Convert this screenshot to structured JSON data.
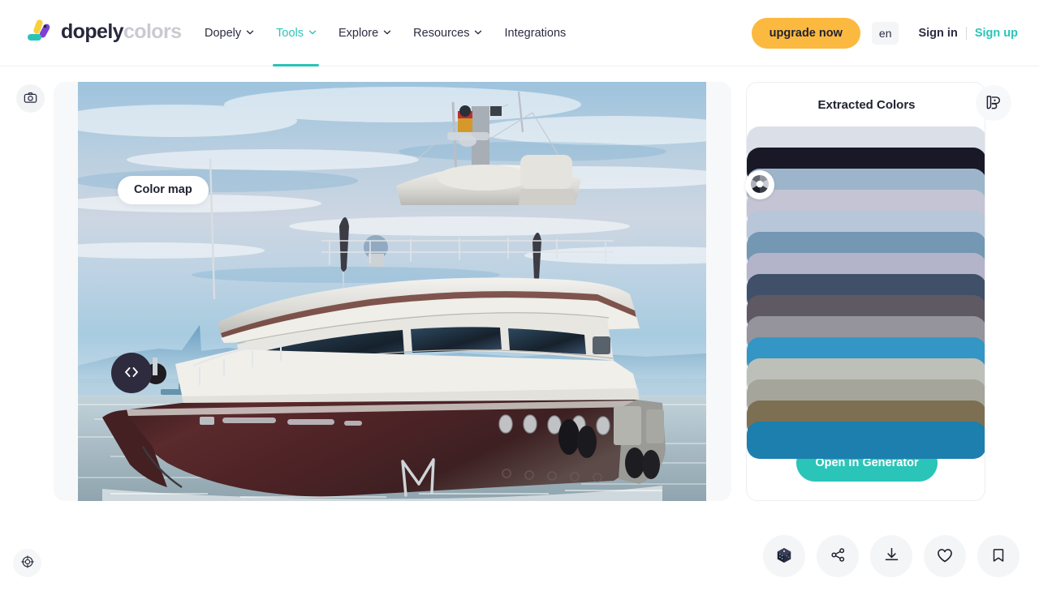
{
  "brand": {
    "name_primary": "dopely",
    "name_secondary": "colors",
    "accent_teal": "#2ac4b8",
    "accent_orange": "#fcb93f",
    "dark": "#27283c"
  },
  "nav": {
    "items": [
      {
        "label": "Dopely",
        "has_caret": true,
        "active": false
      },
      {
        "label": "Tools",
        "has_caret": true,
        "active": true
      },
      {
        "label": "Explore",
        "has_caret": true,
        "active": false
      },
      {
        "label": "Resources",
        "has_caret": true,
        "active": false
      },
      {
        "label": "Integrations",
        "has_caret": false,
        "active": false
      }
    ]
  },
  "header_actions": {
    "upgrade_label": "upgrade now",
    "language": "en",
    "signin_label": "Sign in",
    "signup_label": "Sign up"
  },
  "image_viewer": {
    "colormap_label": "Color map",
    "camera_icon": "camera-icon",
    "arrows_icon": "prev-next-chevrons-icon",
    "picker_icon": "color-wheel-picker-icon",
    "target_icon": "target-crosshair-icon",
    "photo_alt": "white and dark-hulled motor yacht on calm sea under blue sky"
  },
  "palette": {
    "title": "Extracted Colors",
    "generator_label": "Open in Generator",
    "palette_icon": "palette-book-icon",
    "swatches": [
      {
        "hex": "#dbdfe8"
      },
      {
        "hex": "#191827"
      },
      {
        "hex": "#9db5cb"
      },
      {
        "hex": "#c4c4d4"
      },
      {
        "hex": "#b7c6d8"
      },
      {
        "hex": "#7497b3"
      },
      {
        "hex": "#b3b4ca"
      },
      {
        "hex": "#3f5068"
      },
      {
        "hex": "#5f5964"
      },
      {
        "hex": "#95949c"
      },
      {
        "hex": "#3396c5"
      },
      {
        "hex": "#bdbfb9"
      },
      {
        "hex": "#a5a59b"
      },
      {
        "hex": "#7d6f51"
      },
      {
        "hex": "#1c7fad"
      }
    ]
  },
  "bottom_toolbar": {
    "buttons": [
      {
        "name": "random-dice-button",
        "icon": "dice-cube-icon"
      },
      {
        "name": "share-button",
        "icon": "share-nodes-icon"
      },
      {
        "name": "download-button",
        "icon": "download-icon"
      },
      {
        "name": "favorite-button",
        "icon": "heart-icon"
      },
      {
        "name": "bookmark-button",
        "icon": "bookmark-icon"
      }
    ]
  }
}
